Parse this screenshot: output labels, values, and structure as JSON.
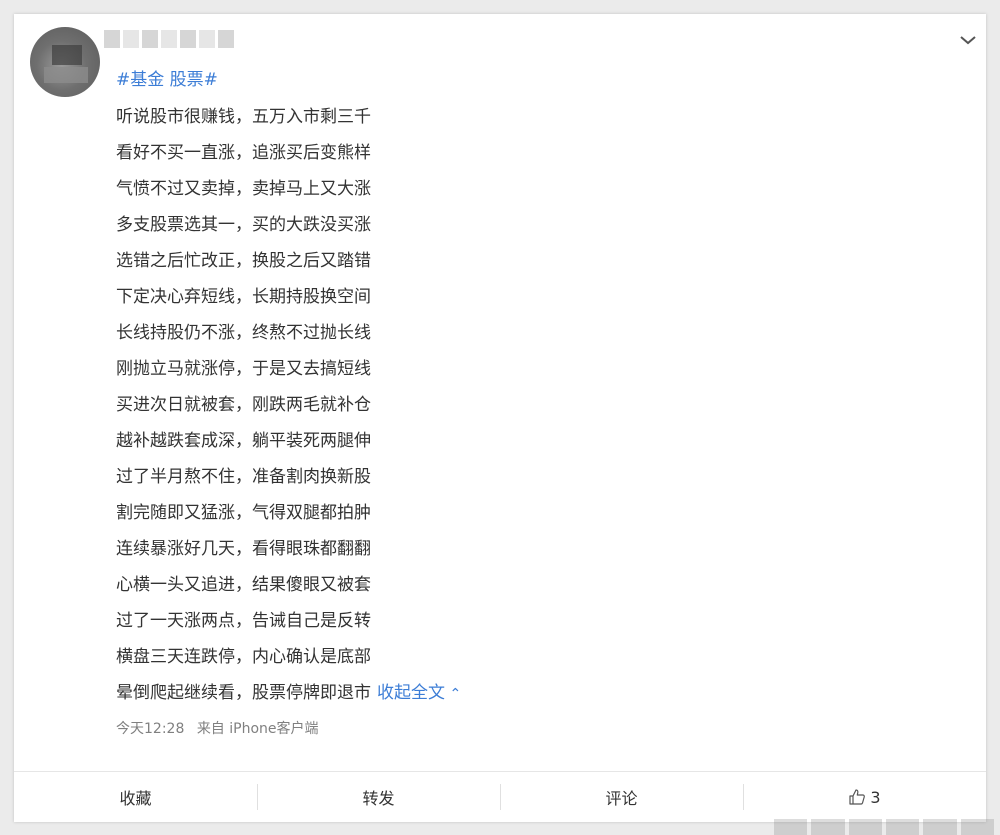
{
  "post": {
    "hashtags": [
      "#基金",
      "股票#"
    ],
    "lines": [
      "听说股市很赚钱，五万入市剩三千",
      "看好不买一直涨，追涨买后变熊样",
      "气愤不过又卖掉，卖掉马上又大涨",
      "多支股票选其一，买的大跌没买涨",
      "选错之后忙改正，换股之后又踏错",
      "下定决心弃短线，长期持股换空间",
      "长线持股仍不涨，终熬不过抛长线",
      "刚抛立马就涨停，于是又去搞短线",
      "买进次日就被套，刚跌两毛就补仓",
      "越补越跌套成深，躺平装死两腿伸",
      "过了半月熬不住，准备割肉换新股",
      "割完随即又猛涨，气得双腿都拍肿",
      "连续暴涨好几天，看得眼珠都翻翻",
      "心横一头又追进，结果傻眼又被套",
      "过了一天涨两点，告诫自己是反转",
      "横盘三天连跌停，内心确认是底部",
      "晕倒爬起继续看，股票停牌即退市"
    ],
    "collapse_label": "收起全文",
    "collapse_caret": "^",
    "time": "今天12:28",
    "source": "来自 iPhone客户端"
  },
  "actions": {
    "favorite": "收藏",
    "repost": "转发",
    "comment": "评论",
    "like_count": "3"
  },
  "colors": {
    "link": "#3c7dd6",
    "text": "#333333",
    "meta": "#808080"
  }
}
